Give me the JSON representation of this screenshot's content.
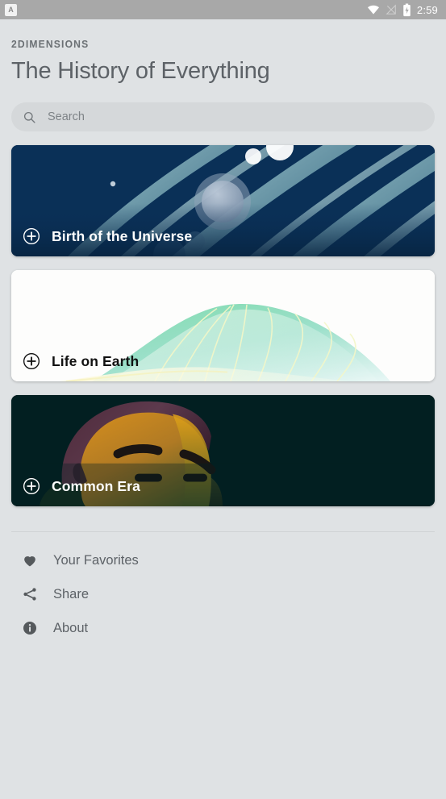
{
  "statusbar": {
    "app_icon": "app-notification-icon",
    "app_icon_glyph": "A",
    "icons": [
      "wifi-icon",
      "cellular-signal-off-icon",
      "battery-charging-icon"
    ],
    "time": "2:59",
    "background_color": "#a8a8a8"
  },
  "header": {
    "brand": "2DIMENSIONS",
    "title": "The History of Everything"
  },
  "search": {
    "icon": "search-icon",
    "placeholder": "Search",
    "value": ""
  },
  "cards": [
    {
      "id": "birth-of-the-universe",
      "label": "Birth of the Universe",
      "expand_icon": "circle-plus-icon",
      "background_color": "#0a3057",
      "accent_color": "#7fb3bd",
      "text_color": "#ffffff",
      "artwork": "galaxy-streaks-and-planets"
    },
    {
      "id": "life-on-earth",
      "label": "Life on Earth",
      "expand_icon": "circle-plus-icon",
      "background_color": "#fdfdfc",
      "accent_color": "#7fd9b4",
      "text_color": "#111111",
      "artwork": "green-leaf"
    },
    {
      "id": "common-era",
      "label": "Common Era",
      "expand_icon": "circle-plus-icon",
      "background_color": "#021f21",
      "accent_color": "#d18a2a",
      "text_color": "#ffffff",
      "artwork": "stylized-face"
    }
  ],
  "menu": [
    {
      "id": "your-favorites",
      "icon": "heart-icon",
      "label": "Your Favorites"
    },
    {
      "id": "share",
      "icon": "share-icon",
      "label": "Share"
    },
    {
      "id": "about",
      "icon": "info-icon",
      "label": "About"
    }
  ],
  "theme": {
    "page_background": "#dfe2e4",
    "text_color": "#5d6267",
    "divider_color": "#cfd3d5",
    "search_background": "#d5d8da"
  }
}
